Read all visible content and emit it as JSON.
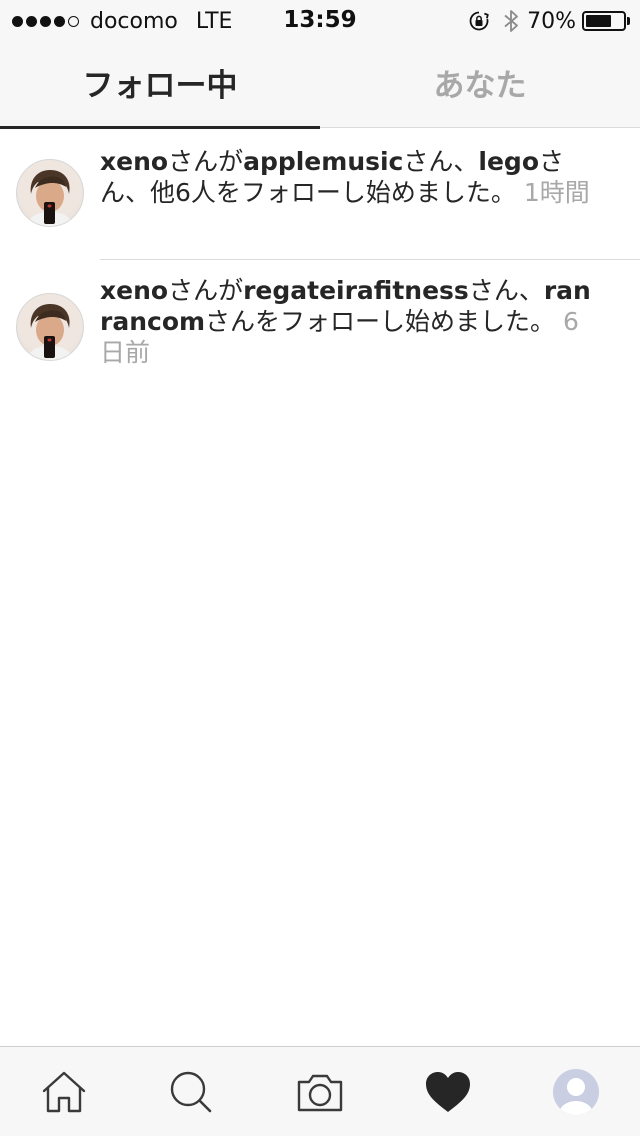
{
  "status_bar": {
    "carrier": "docomo",
    "network": "LTE",
    "time": "13:59",
    "battery_percent_label": "70%",
    "battery_level": 0.7,
    "signal_bars_filled": 4,
    "signal_bars_total": 5,
    "icons": [
      "rotation-lock-icon",
      "bluetooth-icon",
      "battery-icon"
    ]
  },
  "tabs": {
    "following": "フォロー中",
    "you": "あなた",
    "active": "following"
  },
  "feed": [
    {
      "user": "xeno",
      "part1": "さんが",
      "target1": "applemusic",
      "part2": "さん、",
      "target2": "lego",
      "part3": "さん、他6人をフォローし始めました。",
      "time": "1時間"
    },
    {
      "user": "xeno",
      "part1": "さんが",
      "target1": "regateirafitness",
      "part2": "さん、",
      "target2": "ranrancom",
      "part3": "さんをフォローし始めました。",
      "time": "6日前"
    }
  ],
  "bottom_nav": {
    "items": [
      "home-icon",
      "search-icon",
      "camera-icon",
      "heart-icon",
      "profile-icon"
    ],
    "active": "heart-icon"
  },
  "colors": {
    "text": "#262626",
    "muted": "#a8a8a8",
    "bar_background": "#f7f7f7",
    "divider": "#dbdbdb"
  }
}
